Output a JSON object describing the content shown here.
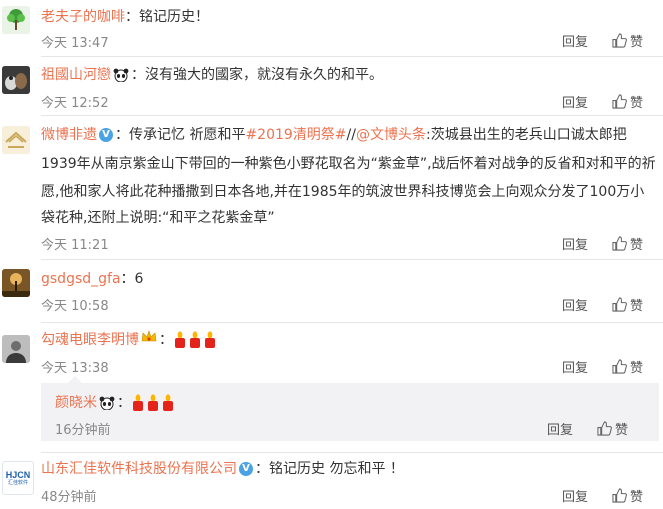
{
  "comments": [
    {
      "name": "老夫子的咖啡",
      "text": "：铭记历史！",
      "time": "今天 13:47",
      "reply": "回复",
      "like": "赞"
    },
    {
      "name": "祖國山河戀",
      "text": "：沒有強大的國家，就沒有永久的和平。",
      "time": "今天 12:52",
      "reply": "回复",
      "like": "赞"
    },
    {
      "name": "微博非遗",
      "text_a": "：传承记忆 祈愿和平",
      "hashtag": "#2019清明祭#",
      "text_b": "//",
      "mention": "@文博头条",
      "text_c": ":茨城县出生的老兵山口诚太郎把",
      "line2": "1939年从南京紫金山下带回的一种紫色小野花取名为“紫金草”,战后怀着对战争的反省和对和平的祈",
      "line3": "愿,他和家人将此花种播撒到日本各地,并在1985年的筑波世界科技博览会上向观众分发了100万小",
      "line4": "袋花种,还附上说明:“和平之花紫金草”",
      "time": "今天 11:21",
      "reply": "回复",
      "like": "赞"
    },
    {
      "name": "gsdgsd_gfa",
      "text": "：6",
      "time": "今天 10:58",
      "reply": "回复",
      "like": "赞"
    },
    {
      "name": "勾魂电眼李明博",
      "text": "：",
      "time": "今天 13:38",
      "reply": "回复",
      "like": "赞"
    },
    {
      "name": "山东汇佳软件科技股份有限公司",
      "text": "：铭记历史 勿忘和平 ！",
      "time": "48分钟前",
      "reply": "回复",
      "like": "赞",
      "avatar_text": "HJCN",
      "avatar_sub": "汇佳软件"
    }
  ],
  "subreply": {
    "name": "颜晓米",
    "text": "：",
    "time": "16分钟前",
    "reply": "回复",
    "like": "赞"
  },
  "colors": {
    "name": "#eb7350",
    "link": "#eb7350",
    "badge": "#4ba3e3"
  }
}
